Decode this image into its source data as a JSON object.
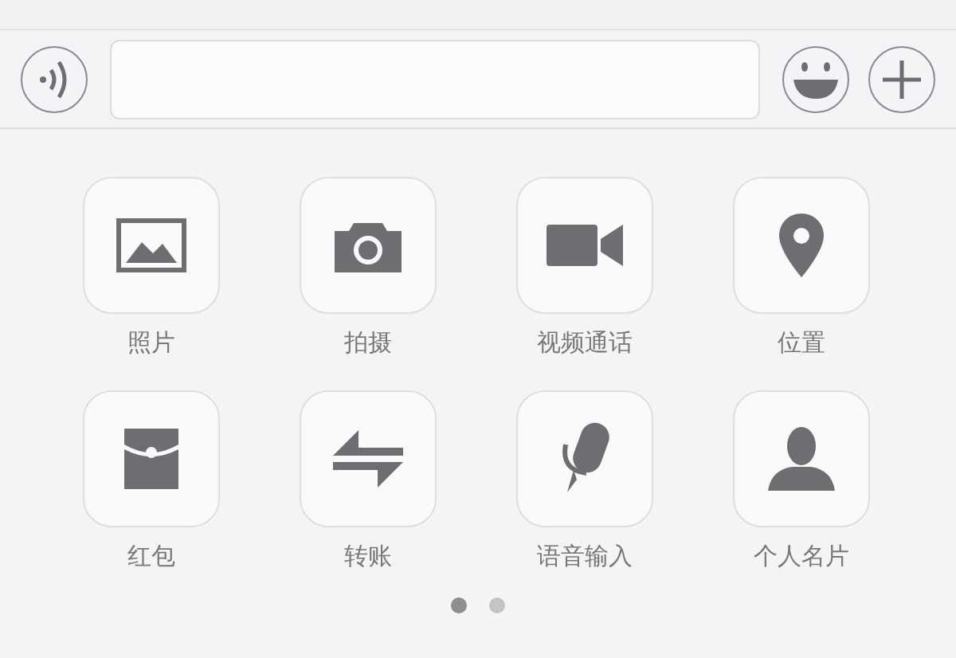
{
  "actions": [
    {
      "label": "照片"
    },
    {
      "label": "拍摄"
    },
    {
      "label": "视频通话"
    },
    {
      "label": "位置"
    },
    {
      "label": "红包"
    },
    {
      "label": "转账"
    },
    {
      "label": "语音输入"
    },
    {
      "label": "个人名片"
    }
  ],
  "pages": [
    {
      "selected": true
    },
    {
      "selected": false
    }
  ]
}
